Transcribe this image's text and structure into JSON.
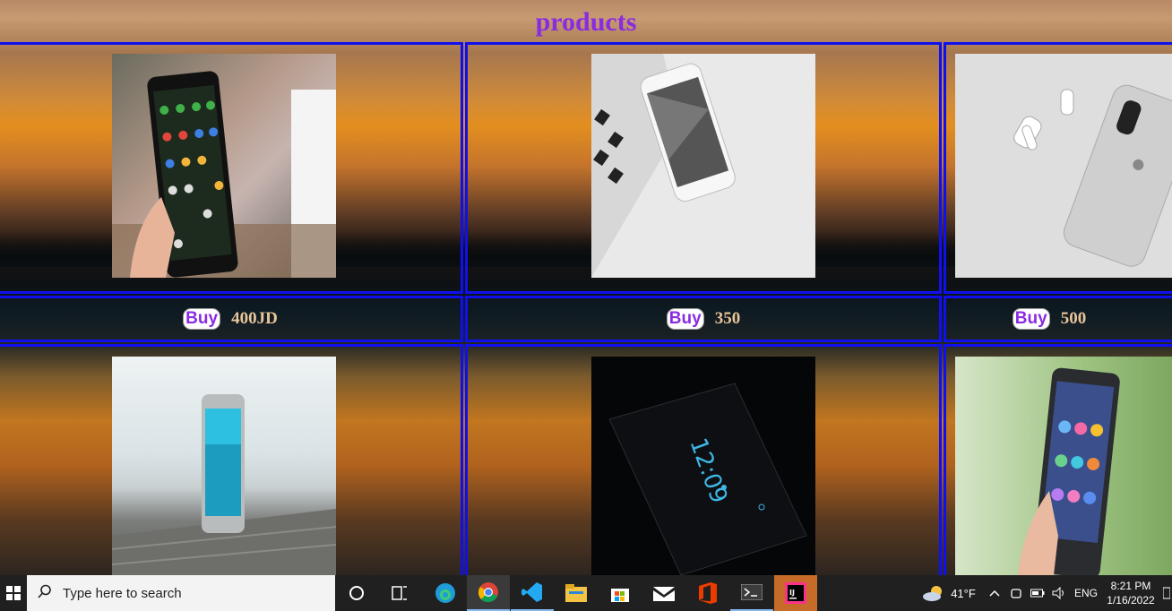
{
  "page": {
    "title": "products"
  },
  "products": [
    {
      "buy_label": "Buy",
      "price": "400JD",
      "image": "phone-in-hand-apps"
    },
    {
      "buy_label": "Buy",
      "price": "350",
      "image": "phone-and-laptop"
    },
    {
      "buy_label": "Buy",
      "price": "500",
      "image": "iphone-and-earbuds"
    },
    {
      "image": "phone-on-wood"
    },
    {
      "image": "phone-dark-clock"
    },
    {
      "image": "asus-phone-in-hand"
    }
  ],
  "taskbar": {
    "search_placeholder": "Type here to search",
    "apps": [
      "cortana-icon",
      "task-view-icon",
      "edge-icon",
      "chrome-icon",
      "vscode-icon",
      "file-explorer-icon",
      "store-icon",
      "mail-icon",
      "office-icon",
      "terminal-icon",
      "intellij-icon"
    ],
    "weather": "41°F",
    "language": "ENG",
    "time": "8:21 PM",
    "date": "1/16/2022"
  },
  "colors": {
    "title": "#8a2be2",
    "border": "#1010ee",
    "price": "#e8c59a"
  }
}
